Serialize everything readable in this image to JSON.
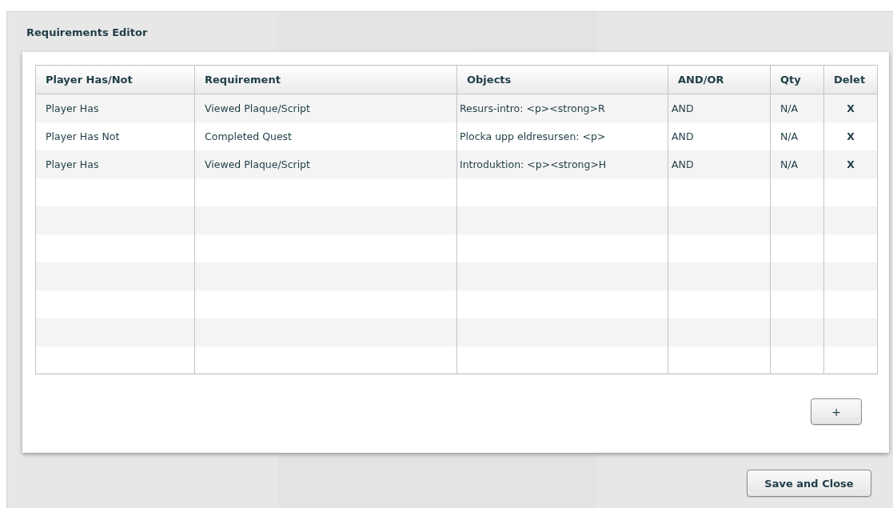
{
  "dialog": {
    "title": "Requirements Editor"
  },
  "table": {
    "columns": [
      "Player Has/Not",
      "Requirement",
      "Objects",
      "AND/OR",
      "Qty",
      "Delet"
    ],
    "rows": [
      {
        "player": "Player Has",
        "requirement": "Viewed Plaque/Script",
        "objects": "Resurs-intro: <p><strong>R",
        "and_or": "AND",
        "qty": "N/A",
        "delete": "X"
      },
      {
        "player": "Player Has Not",
        "requirement": "Completed Quest",
        "objects": "Plocka upp eldresursen: <p>",
        "and_or": "AND",
        "qty": "N/A",
        "delete": "X"
      },
      {
        "player": "Player Has",
        "requirement": "Viewed Plaque/Script",
        "objects": "Introduktion: <p><strong>H",
        "and_or": "AND",
        "qty": "N/A",
        "delete": "X"
      }
    ]
  },
  "add_button": {
    "label": "+"
  },
  "save_button": {
    "label": "Save and Close"
  }
}
